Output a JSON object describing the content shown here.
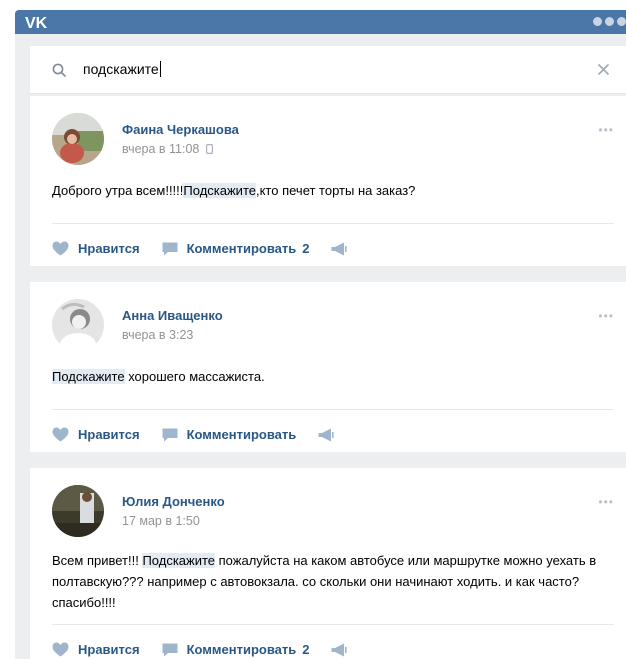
{
  "colors": {
    "header": "#4a76a8",
    "link": "#2a5885",
    "background": "#edeef0",
    "highlight": "#e2eaf3",
    "meta": "#939393"
  },
  "header": {
    "logo_icon": "vk-logo-icon",
    "menu_icon": "three-dots-icon"
  },
  "search": {
    "icon": "search-icon",
    "value": "подскажите",
    "clear_icon": "close-icon"
  },
  "posts": [
    {
      "author": "Фаина Черкашова",
      "time": "вчера в 11:08",
      "device_icon": "phone-icon",
      "text_before": "Доброго утра всем!!!!!",
      "highlight": "Подскажите",
      "text_after": ",кто печет торты на заказ?",
      "like_label": "Нравится",
      "comment_label": "Комментировать",
      "comment_count": "2",
      "share_icon": "megaphone-icon"
    },
    {
      "author": "Анна Иващенко",
      "time": "вчера в 3:23",
      "text_before": "",
      "highlight": "Подскажите",
      "text_after": " хорошего массажиста.",
      "like_label": "Нравится",
      "comment_label": "Комментировать",
      "comment_count": "",
      "share_icon": "megaphone-icon"
    },
    {
      "author": "Юлия Донченко",
      "time": "17 мар в 1:50",
      "text_before": "Всем привет!!! ",
      "highlight": "Подскажите",
      "text_after": " пожалуйста на каком автобусе или маршрутке можно уехать в полтавскую??? например с автовокзала. со скольки они начинают ходить. и как часто? спасибо!!!!",
      "like_label": "Нравится",
      "comment_label": "Комментировать",
      "comment_count": "2",
      "share_icon": "megaphone-icon"
    }
  ]
}
